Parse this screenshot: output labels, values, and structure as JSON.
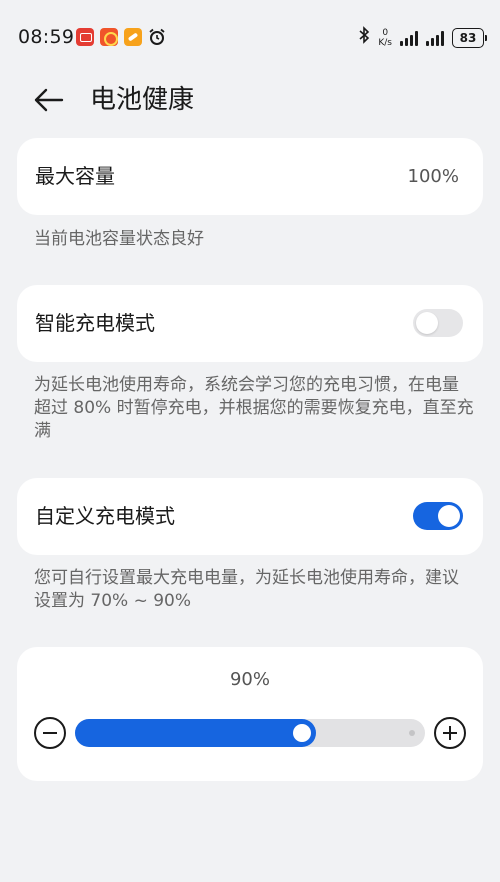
{
  "status_bar": {
    "time": "08:59",
    "net_speed_value": "0",
    "net_speed_unit": "K/s",
    "battery_level": "83"
  },
  "header": {
    "title": "电池健康"
  },
  "max_capacity": {
    "label": "最大容量",
    "value": "100%",
    "note": "当前电池容量状态良好"
  },
  "smart_charging": {
    "label": "智能充电模式",
    "enabled": false,
    "note": "为延长电池使用寿命，系统会学习您的充电习惯，在电量超过 80% 时暂停充电，并根据您的需要恢复充电，直至充满"
  },
  "custom_charging": {
    "label": "自定义充电模式",
    "enabled": true,
    "note": "您可自行设置最大充电电量，为延长电池使用寿命，建议设置为 70% ~ 90%"
  },
  "charge_limit": {
    "value_label": "90%",
    "slider_fraction": 0.69
  },
  "colors": {
    "accent": "#1665e0",
    "background": "#f1f2f4",
    "card": "#ffffff"
  },
  "icons": {
    "back": "arrow-left-icon",
    "bluetooth": "bluetooth-icon",
    "alarm": "alarm-icon",
    "minus": "minus-circle-icon",
    "plus": "plus-circle-icon"
  }
}
